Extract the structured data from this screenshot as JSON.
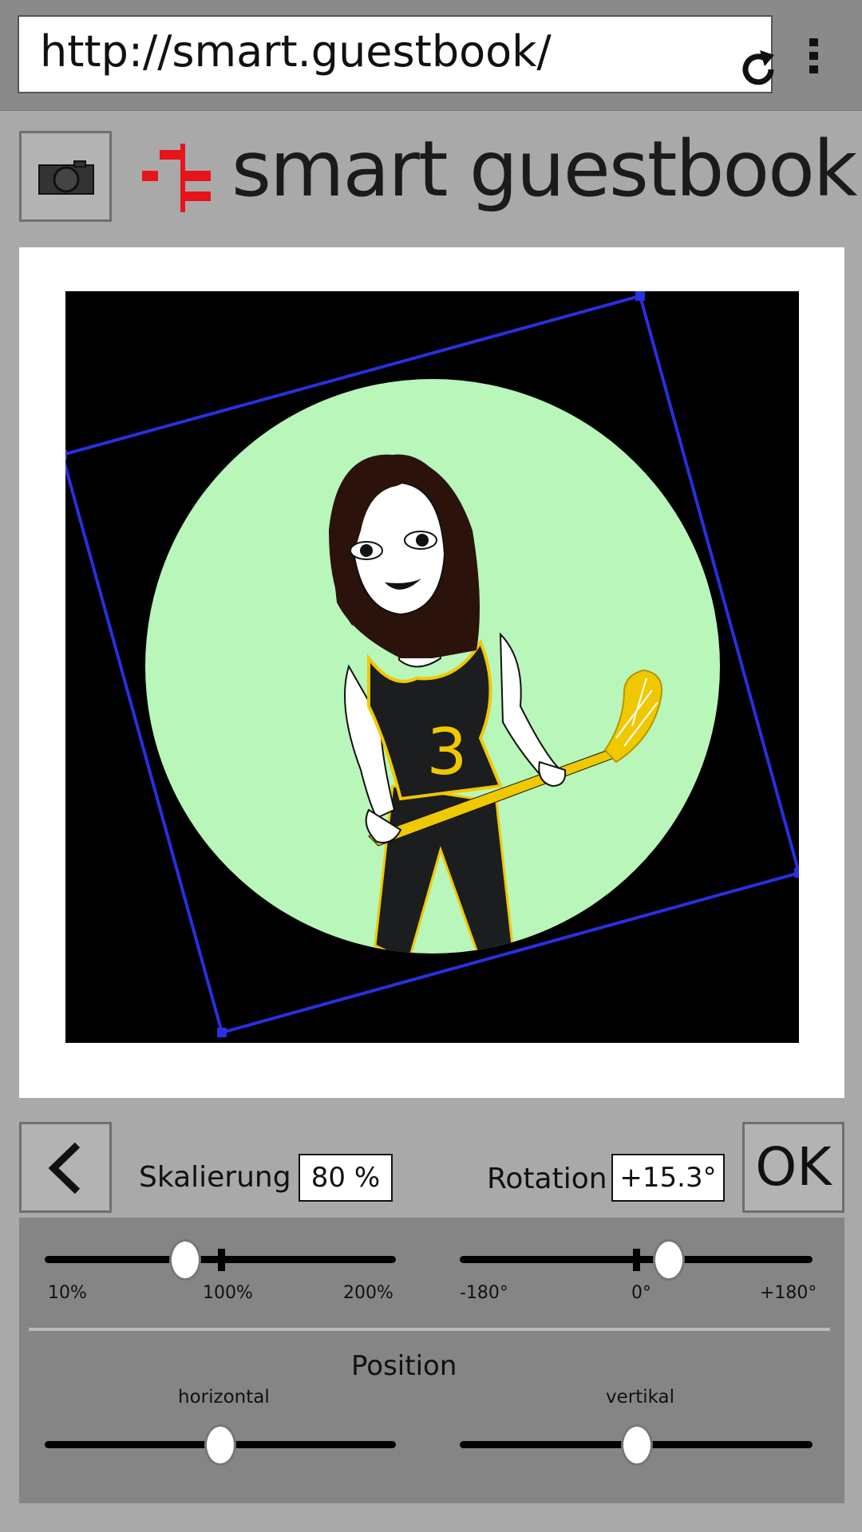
{
  "browser": {
    "url": "http://smart.guestbook/",
    "reload_icon": "reload-icon",
    "menu_icon": "kebab-menu-icon"
  },
  "header": {
    "camera_icon": "camera-icon",
    "title": "smart guestbook",
    "logo_color": "#e8141b"
  },
  "image": {
    "jersey_number": "3",
    "background_color": "#000000",
    "circle_color": "#b9f6b9",
    "crop_frame_color": "#2a2fe0"
  },
  "controls": {
    "back_icon": "chevron-left-icon",
    "ok_label": "OK",
    "scaling": {
      "label": "Skalierung",
      "value": "80 %",
      "min_label": "10%",
      "mid_label": "100%",
      "max_label": "200%",
      "value_pct": 80
    },
    "rotation": {
      "label": "Rotation",
      "value": "+15.3°",
      "min_label": "-180°",
      "mid_label": "0°",
      "max_label": "+180°",
      "value_deg": 15.3
    },
    "position": {
      "title": "Position",
      "horizontal_label": "horizontal",
      "vertical_label": "vertikal",
      "horizontal_fraction": 0.5,
      "vertical_fraction": 0.5
    }
  }
}
